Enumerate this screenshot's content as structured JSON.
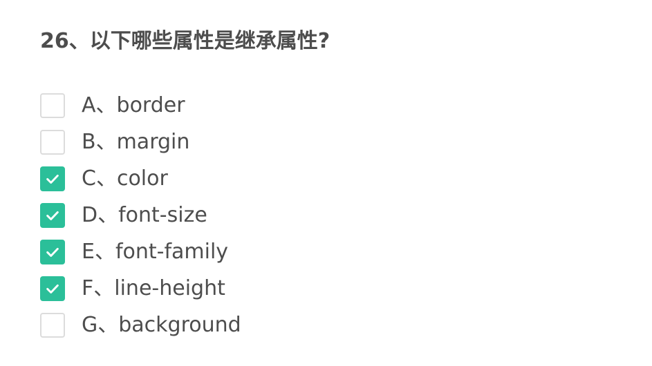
{
  "question": {
    "text": "26、以下哪些属性是继承属性?"
  },
  "options": [
    {
      "label": "A、border",
      "checked": false
    },
    {
      "label": "B、margin",
      "checked": false
    },
    {
      "label": "C、color",
      "checked": true
    },
    {
      "label": "D、font-size",
      "checked": true
    },
    {
      "label": "E、font-family",
      "checked": true
    },
    {
      "label": "F、line-height",
      "checked": true
    },
    {
      "label": "G、background",
      "checked": false
    }
  ],
  "colors": {
    "accent": "#2bbf99",
    "text": "#4d4d4d",
    "checkbox_border": "#dcdcdc"
  },
  "icons": {
    "checked": "check-icon"
  }
}
